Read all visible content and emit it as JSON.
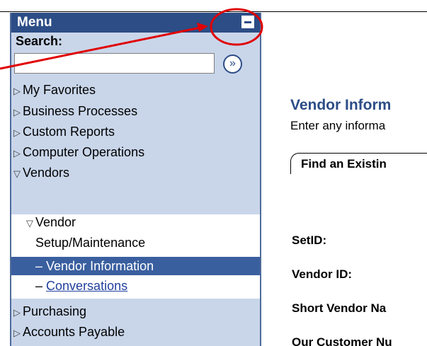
{
  "menu": {
    "title": "Menu",
    "collapse_icon": "minus-icon",
    "search_label": "Search:",
    "search_value": "",
    "go_icon": "double-chevron-right-icon",
    "go_glyph": "»",
    "items": [
      {
        "label": "My Favorites",
        "state": "collapsed"
      },
      {
        "label": "Business Processes",
        "state": "collapsed"
      },
      {
        "label": "Custom Reports",
        "state": "collapsed"
      },
      {
        "label": "Computer Operations",
        "state": "collapsed"
      },
      {
        "label": "Vendors",
        "state": "expanded"
      }
    ],
    "sub": {
      "group_label_line1": "Vendor",
      "group_label_line2": "Setup/Maintenance",
      "selected_label": "– Vendor Information",
      "link_label": "Conversations",
      "link_prefix": "–"
    },
    "items_after": [
      {
        "label": "Purchasing",
        "state": "collapsed"
      },
      {
        "label": "Accounts Payable",
        "state": "collapsed"
      }
    ],
    "collapsed_glyph": "▷",
    "expanded_glyph": "▽"
  },
  "content": {
    "title": "Vendor Inform",
    "description": "Enter any informa",
    "tab_label": "Find an Existin",
    "fields": [
      "SetID:",
      "Vendor ID:",
      "Short Vendor Na",
      "Our Customer Nu"
    ]
  },
  "colors": {
    "header_bg": "#2c4d86",
    "panel_bg": "#c9d6ea",
    "selected_bg": "#3a5f9f",
    "annotation": "#e00000",
    "title_color": "#2c4d86"
  }
}
